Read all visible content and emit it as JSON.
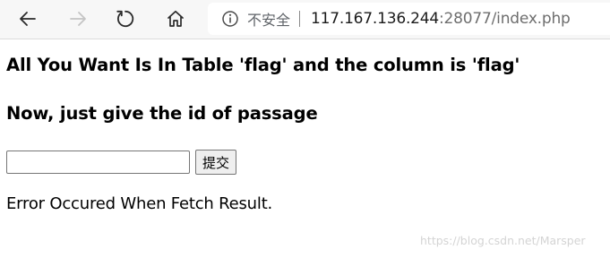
{
  "browser": {
    "security_label": "不安全",
    "url_host": "117.167.136.244",
    "url_rest": ":28077/index.php",
    "icons": {
      "back": "arrow-left-icon",
      "forward": "arrow-right-icon",
      "refresh": "refresh-icon",
      "home": "home-icon",
      "info": "info-circle-icon"
    }
  },
  "page": {
    "heading_1": "All You Want Is In Table 'flag' and the column is 'flag'",
    "heading_2": "Now, just give the id of passage",
    "form": {
      "input_value": "",
      "submit_label": "提交"
    },
    "result_text": "Error Occured When Fetch Result."
  },
  "watermark": "https://blog.csdn.net/Marsper"
}
